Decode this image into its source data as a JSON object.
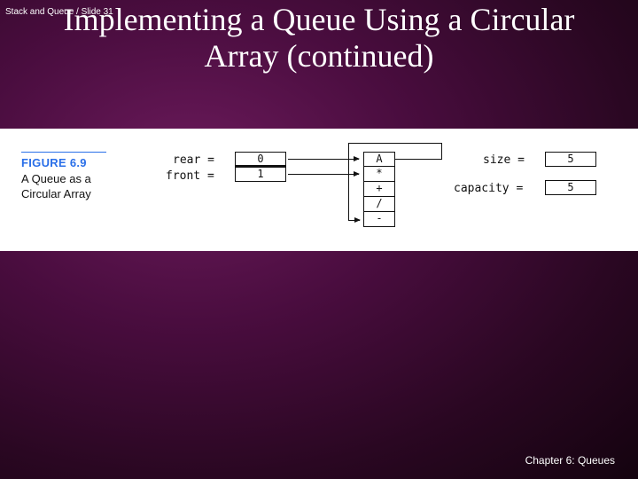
{
  "header": {
    "label": "Stack and Queue / Slide 31"
  },
  "title": "Implementing a Queue Using a Circular Array (continued)",
  "figure": {
    "number": "FIGURE 6.9",
    "caption_l1": "A Queue as a",
    "caption_l2": "Circular Array",
    "labels": {
      "rear": "rear =",
      "front": "front =",
      "size": "size =",
      "capacity": "capacity ="
    },
    "indices": {
      "rear": "0",
      "front": "1"
    },
    "array": [
      "A",
      "*",
      "+",
      "/",
      "-"
    ],
    "values": {
      "size": "5",
      "capacity": "5"
    }
  },
  "footer": "Chapter 6: Queues"
}
